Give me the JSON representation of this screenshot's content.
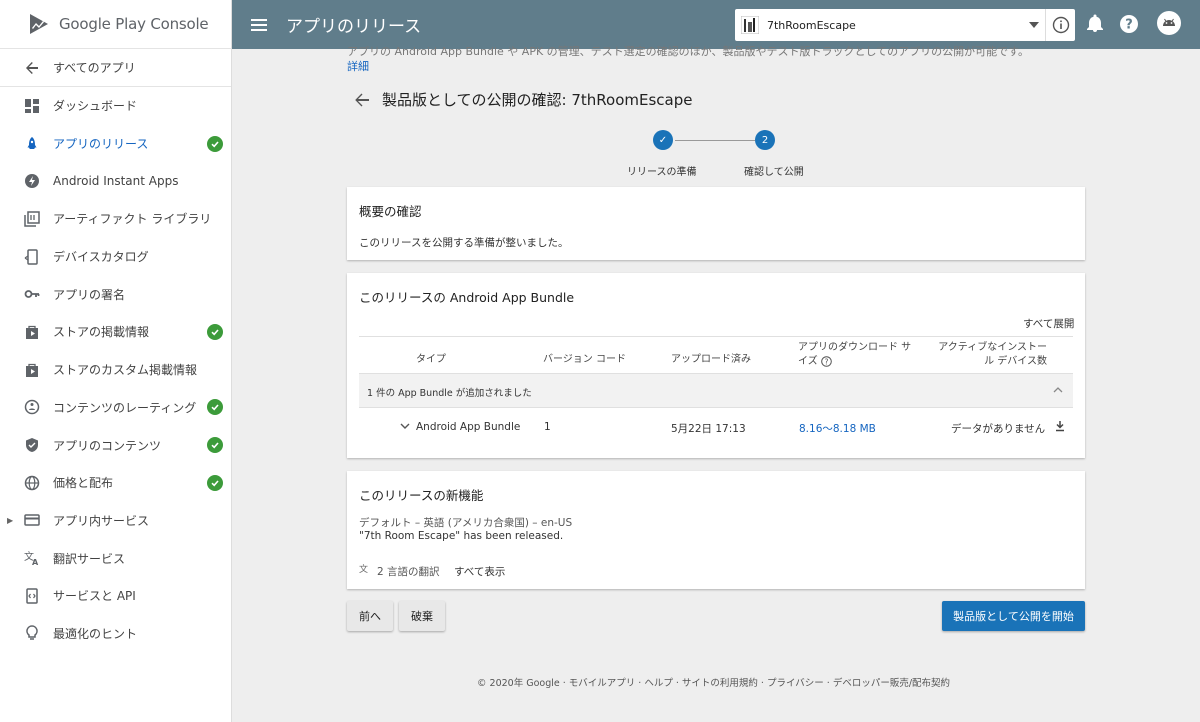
{
  "brand": {
    "name": "Google Play Console"
  },
  "sidebar": {
    "back_label": "すべてのアプリ",
    "items": [
      {
        "label": "ダッシュボード",
        "icon": "dashboard-icon",
        "checked": false,
        "active": false
      },
      {
        "label": "アプリのリリース",
        "icon": "rocket-icon",
        "checked": true,
        "active": true
      },
      {
        "label": "Android Instant Apps",
        "icon": "bolt-icon",
        "checked": false,
        "active": false
      },
      {
        "label": "アーティファクト ライブラリ",
        "icon": "library-icon",
        "checked": false,
        "active": false
      },
      {
        "label": "デバイスカタログ",
        "icon": "device-icon",
        "checked": false,
        "active": false
      },
      {
        "label": "アプリの署名",
        "icon": "key-icon",
        "checked": false,
        "active": false
      },
      {
        "label": "ストアの掲載情報",
        "icon": "store-icon",
        "checked": true,
        "active": false
      },
      {
        "label": "ストアのカスタム掲載情報",
        "icon": "store-custom-icon",
        "checked": false,
        "active": false
      },
      {
        "label": "コンテンツのレーティング",
        "icon": "rating-icon",
        "checked": true,
        "active": false
      },
      {
        "label": "アプリのコンテンツ",
        "icon": "shield-icon",
        "checked": true,
        "active": false
      },
      {
        "label": "価格と配布",
        "icon": "globe-icon",
        "checked": true,
        "active": false
      },
      {
        "label": "アプリ内サービス",
        "icon": "card-icon",
        "checked": false,
        "active": false
      },
      {
        "label": "翻訳サービス",
        "icon": "translate-icon",
        "checked": false,
        "active": false
      },
      {
        "label": "サービスと API",
        "icon": "api-icon",
        "checked": false,
        "active": false
      },
      {
        "label": "最適化のヒント",
        "icon": "bulb-icon",
        "checked": false,
        "active": false
      }
    ]
  },
  "topbar": {
    "title": "アプリのリリース",
    "app_name": "7thRoomEscape"
  },
  "main": {
    "intro_text": "アプリの Android App Bundle や APK の管理、テスト選定の確認のほか、製品版やテスト版トラックとしてのアプリの公開が可能です。",
    "intro_link": "詳細",
    "heading": "製品版としての公開の確認: 7thRoomEscape",
    "steps": [
      {
        "number": "✓",
        "label": "リリースの準備"
      },
      {
        "number": "2",
        "label": "確認して公開"
      }
    ],
    "summary": {
      "title": "概要の確認",
      "text": "このリリースを公開する準備が整いました。"
    },
    "bundles": {
      "title": "このリリースの Android App Bundle",
      "expand_all": "すべて展開",
      "columns": [
        "タイプ",
        "バージョン コード",
        "アップロード済み",
        "アプリのダウンロード サイズ",
        "アクティブなインストール デバイス数"
      ],
      "group_label": "1 件の App Bundle が追加されました",
      "row": {
        "type": "Android App Bundle",
        "version": "1",
        "uploaded": "5月22日 17:13",
        "size": "8.16～8.18 MB",
        "installs": "データがありません"
      }
    },
    "whats_new": {
      "title": "このリリースの新機能",
      "locale": "デフォルト – 英語 (アメリカ合衆国) – en-US",
      "text": "\"7th Room Escape\" has been released.",
      "translations": "2 言語の翻訳",
      "show_all": "すべて表示"
    },
    "buttons": {
      "previous": "前へ",
      "discard": "破棄",
      "rollout": "製品版として公開を開始"
    },
    "footer": "© 2020年 Google · モバイルアプリ · ヘルプ · サイトの利用規約 · プライバシー · デベロッパー販売/配布契約"
  },
  "colors": {
    "topbar": "#607d8b",
    "accent": "#1a73b8",
    "check": "#3c9b3a"
  }
}
